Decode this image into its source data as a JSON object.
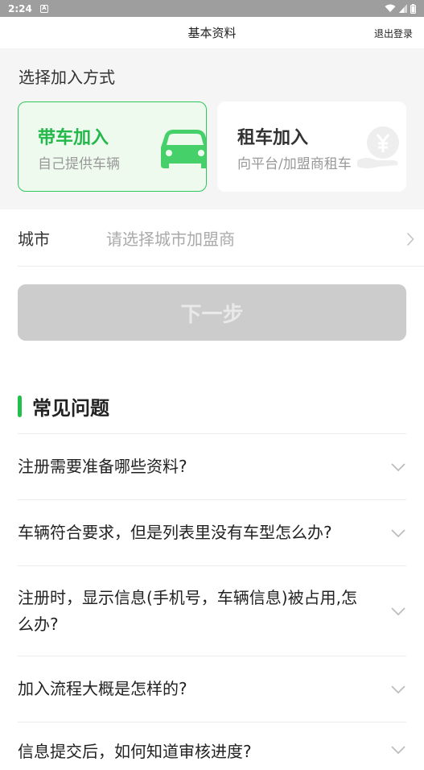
{
  "status_bar": {
    "time": "2:24",
    "notif_badge": "A"
  },
  "header": {
    "title": "基本资料",
    "logout_label": "退出登录"
  },
  "join": {
    "section_label": "选择加入方式",
    "options": [
      {
        "title": "带车加入",
        "subtitle": "自己提供车辆",
        "selected": true,
        "icon": "car-icon"
      },
      {
        "title": "租车加入",
        "subtitle": "向平台/加盟商租车",
        "selected": false,
        "icon": "yuan-money-icon"
      }
    ]
  },
  "city": {
    "label": "城市",
    "placeholder": "请选择城市加盟商"
  },
  "next_button": {
    "label": "下一步",
    "enabled": false
  },
  "faq": {
    "title": "常见问题",
    "items": [
      {
        "question": "注册需要准备哪些资料?"
      },
      {
        "question": "车辆符合要求，但是列表里没有车型怎么办?"
      },
      {
        "question": "注册时，显示信息(手机号，车辆信息)被占用,怎么办?"
      },
      {
        "question": "加入流程大概是怎样的?"
      },
      {
        "question": "信息提交后，如何知道审核进度?"
      }
    ]
  },
  "colors": {
    "accent": "#22c04a",
    "selected_card_bg": "#eefaee",
    "disabled_button": "#cccccc"
  }
}
